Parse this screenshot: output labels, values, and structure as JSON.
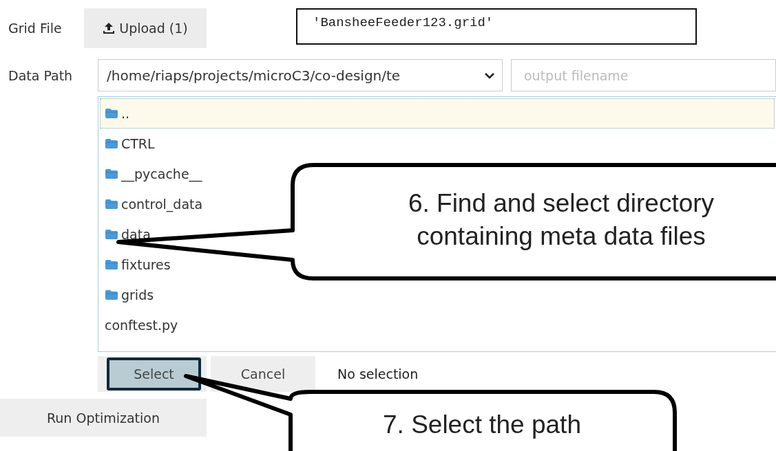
{
  "grid_file": {
    "label": "Grid File",
    "upload_button": "Upload (1)",
    "filename": "'BansheeFeeder123.grid'"
  },
  "data_path": {
    "label": "Data Path",
    "path": "/home/riaps/projects/microC3/co-design/te",
    "output": {
      "placeholder": "output filename"
    }
  },
  "file_list": [
    {
      "kind": "folder",
      "name": "..",
      "selected": true
    },
    {
      "kind": "folder",
      "name": "CTRL",
      "selected": false
    },
    {
      "kind": "folder",
      "name": "__pycache__",
      "selected": false
    },
    {
      "kind": "folder",
      "name": "control_data",
      "selected": false
    },
    {
      "kind": "folder",
      "name": "data",
      "selected": false
    },
    {
      "kind": "folder",
      "name": "fixtures",
      "selected": false
    },
    {
      "kind": "folder",
      "name": "grids",
      "selected": false
    },
    {
      "kind": "file",
      "name": "conftest.py",
      "selected": false
    }
  ],
  "dialog_buttons": [
    {
      "label": "Select",
      "focused": true
    },
    {
      "label": "Cancel",
      "focused": false
    }
  ],
  "selection_status": "No selection",
  "run_button": "Run Optimization",
  "callouts": [
    {
      "text": "6. Find and select directory containing meta data files"
    },
    {
      "text": "7. Select the path"
    }
  ]
}
